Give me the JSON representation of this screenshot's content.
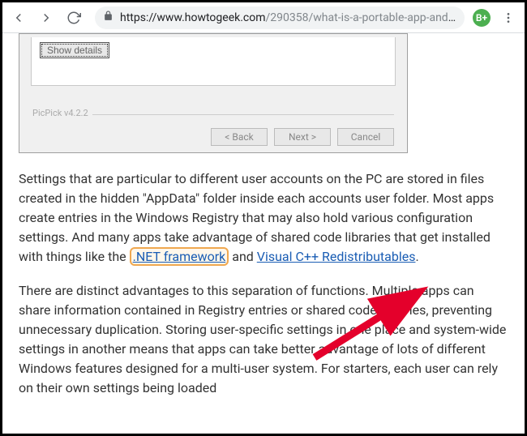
{
  "browser": {
    "url_domain": "https://www.howtogeek.com",
    "url_path": "/290358/what-is-a-portable-app-and-...",
    "extension_badge": "B+"
  },
  "installer": {
    "show_details": "Show details",
    "version_label": "PicPick v4.2.2",
    "back": "< Back",
    "next": "Next >",
    "cancel": "Cancel"
  },
  "article": {
    "p1_a": "Settings that are particular to different user accounts on the PC are stored in files created in the hidden \"AppData\" folder inside each accounts user folder. Most apps create entries in the Windows Registry that may also hold various configuration settings. And many apps take advantage of shared code libraries that get installed with things like the ",
    "link_net": ".NET framework",
    "p1_b": " and ",
    "link_vc": "Visual C++ Redistributables",
    "p1_c": ".",
    "p2": "There are distinct advantages to this separation of functions. Multiple apps can share information contained in Registry entries or shared code libraries, preventing unnecessary duplication. Storing user-specific settings in one place and system-wide settings in another means that apps can take better advantage of lots of different Windows features designed for a multi-user system. For starters, each user can rely on their own settings being loaded"
  }
}
